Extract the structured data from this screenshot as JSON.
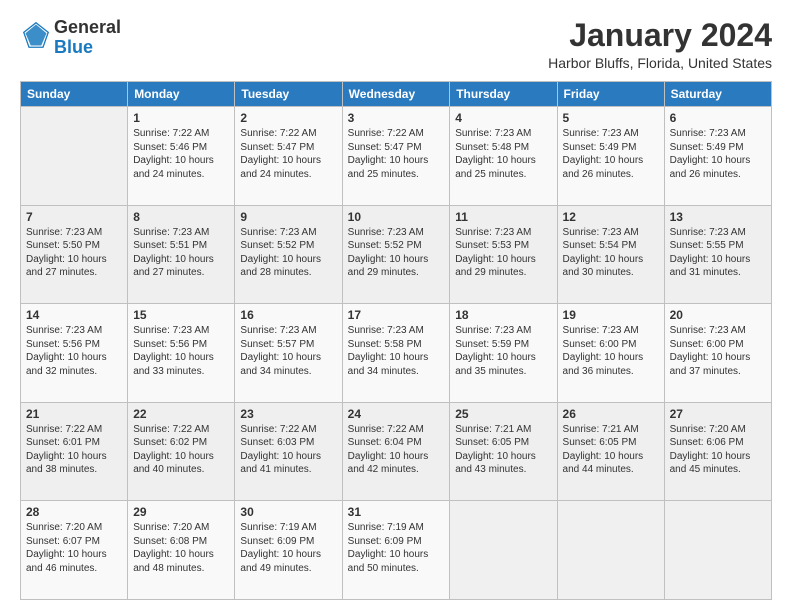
{
  "header": {
    "logo": {
      "line1": "General",
      "line2": "Blue"
    },
    "title": "January 2024",
    "location": "Harbor Bluffs, Florida, United States"
  },
  "calendar": {
    "days_of_week": [
      "Sunday",
      "Monday",
      "Tuesday",
      "Wednesday",
      "Thursday",
      "Friday",
      "Saturday"
    ],
    "weeks": [
      [
        {
          "day": "",
          "info": ""
        },
        {
          "day": "1",
          "info": "Sunrise: 7:22 AM\nSunset: 5:46 PM\nDaylight: 10 hours\nand 24 minutes."
        },
        {
          "day": "2",
          "info": "Sunrise: 7:22 AM\nSunset: 5:47 PM\nDaylight: 10 hours\nand 24 minutes."
        },
        {
          "day": "3",
          "info": "Sunrise: 7:22 AM\nSunset: 5:47 PM\nDaylight: 10 hours\nand 25 minutes."
        },
        {
          "day": "4",
          "info": "Sunrise: 7:23 AM\nSunset: 5:48 PM\nDaylight: 10 hours\nand 25 minutes."
        },
        {
          "day": "5",
          "info": "Sunrise: 7:23 AM\nSunset: 5:49 PM\nDaylight: 10 hours\nand 26 minutes."
        },
        {
          "day": "6",
          "info": "Sunrise: 7:23 AM\nSunset: 5:49 PM\nDaylight: 10 hours\nand 26 minutes."
        }
      ],
      [
        {
          "day": "7",
          "info": "Sunrise: 7:23 AM\nSunset: 5:50 PM\nDaylight: 10 hours\nand 27 minutes."
        },
        {
          "day": "8",
          "info": "Sunrise: 7:23 AM\nSunset: 5:51 PM\nDaylight: 10 hours\nand 27 minutes."
        },
        {
          "day": "9",
          "info": "Sunrise: 7:23 AM\nSunset: 5:52 PM\nDaylight: 10 hours\nand 28 minutes."
        },
        {
          "day": "10",
          "info": "Sunrise: 7:23 AM\nSunset: 5:52 PM\nDaylight: 10 hours\nand 29 minutes."
        },
        {
          "day": "11",
          "info": "Sunrise: 7:23 AM\nSunset: 5:53 PM\nDaylight: 10 hours\nand 29 minutes."
        },
        {
          "day": "12",
          "info": "Sunrise: 7:23 AM\nSunset: 5:54 PM\nDaylight: 10 hours\nand 30 minutes."
        },
        {
          "day": "13",
          "info": "Sunrise: 7:23 AM\nSunset: 5:55 PM\nDaylight: 10 hours\nand 31 minutes."
        }
      ],
      [
        {
          "day": "14",
          "info": "Sunrise: 7:23 AM\nSunset: 5:56 PM\nDaylight: 10 hours\nand 32 minutes."
        },
        {
          "day": "15",
          "info": "Sunrise: 7:23 AM\nSunset: 5:56 PM\nDaylight: 10 hours\nand 33 minutes."
        },
        {
          "day": "16",
          "info": "Sunrise: 7:23 AM\nSunset: 5:57 PM\nDaylight: 10 hours\nand 34 minutes."
        },
        {
          "day": "17",
          "info": "Sunrise: 7:23 AM\nSunset: 5:58 PM\nDaylight: 10 hours\nand 34 minutes."
        },
        {
          "day": "18",
          "info": "Sunrise: 7:23 AM\nSunset: 5:59 PM\nDaylight: 10 hours\nand 35 minutes."
        },
        {
          "day": "19",
          "info": "Sunrise: 7:23 AM\nSunset: 6:00 PM\nDaylight: 10 hours\nand 36 minutes."
        },
        {
          "day": "20",
          "info": "Sunrise: 7:23 AM\nSunset: 6:00 PM\nDaylight: 10 hours\nand 37 minutes."
        }
      ],
      [
        {
          "day": "21",
          "info": "Sunrise: 7:22 AM\nSunset: 6:01 PM\nDaylight: 10 hours\nand 38 minutes."
        },
        {
          "day": "22",
          "info": "Sunrise: 7:22 AM\nSunset: 6:02 PM\nDaylight: 10 hours\nand 40 minutes."
        },
        {
          "day": "23",
          "info": "Sunrise: 7:22 AM\nSunset: 6:03 PM\nDaylight: 10 hours\nand 41 minutes."
        },
        {
          "day": "24",
          "info": "Sunrise: 7:22 AM\nSunset: 6:04 PM\nDaylight: 10 hours\nand 42 minutes."
        },
        {
          "day": "25",
          "info": "Sunrise: 7:21 AM\nSunset: 6:05 PM\nDaylight: 10 hours\nand 43 minutes."
        },
        {
          "day": "26",
          "info": "Sunrise: 7:21 AM\nSunset: 6:05 PM\nDaylight: 10 hours\nand 44 minutes."
        },
        {
          "day": "27",
          "info": "Sunrise: 7:20 AM\nSunset: 6:06 PM\nDaylight: 10 hours\nand 45 minutes."
        }
      ],
      [
        {
          "day": "28",
          "info": "Sunrise: 7:20 AM\nSunset: 6:07 PM\nDaylight: 10 hours\nand 46 minutes."
        },
        {
          "day": "29",
          "info": "Sunrise: 7:20 AM\nSunset: 6:08 PM\nDaylight: 10 hours\nand 48 minutes."
        },
        {
          "day": "30",
          "info": "Sunrise: 7:19 AM\nSunset: 6:09 PM\nDaylight: 10 hours\nand 49 minutes."
        },
        {
          "day": "31",
          "info": "Sunrise: 7:19 AM\nSunset: 6:09 PM\nDaylight: 10 hours\nand 50 minutes."
        },
        {
          "day": "",
          "info": ""
        },
        {
          "day": "",
          "info": ""
        },
        {
          "day": "",
          "info": ""
        }
      ]
    ]
  }
}
